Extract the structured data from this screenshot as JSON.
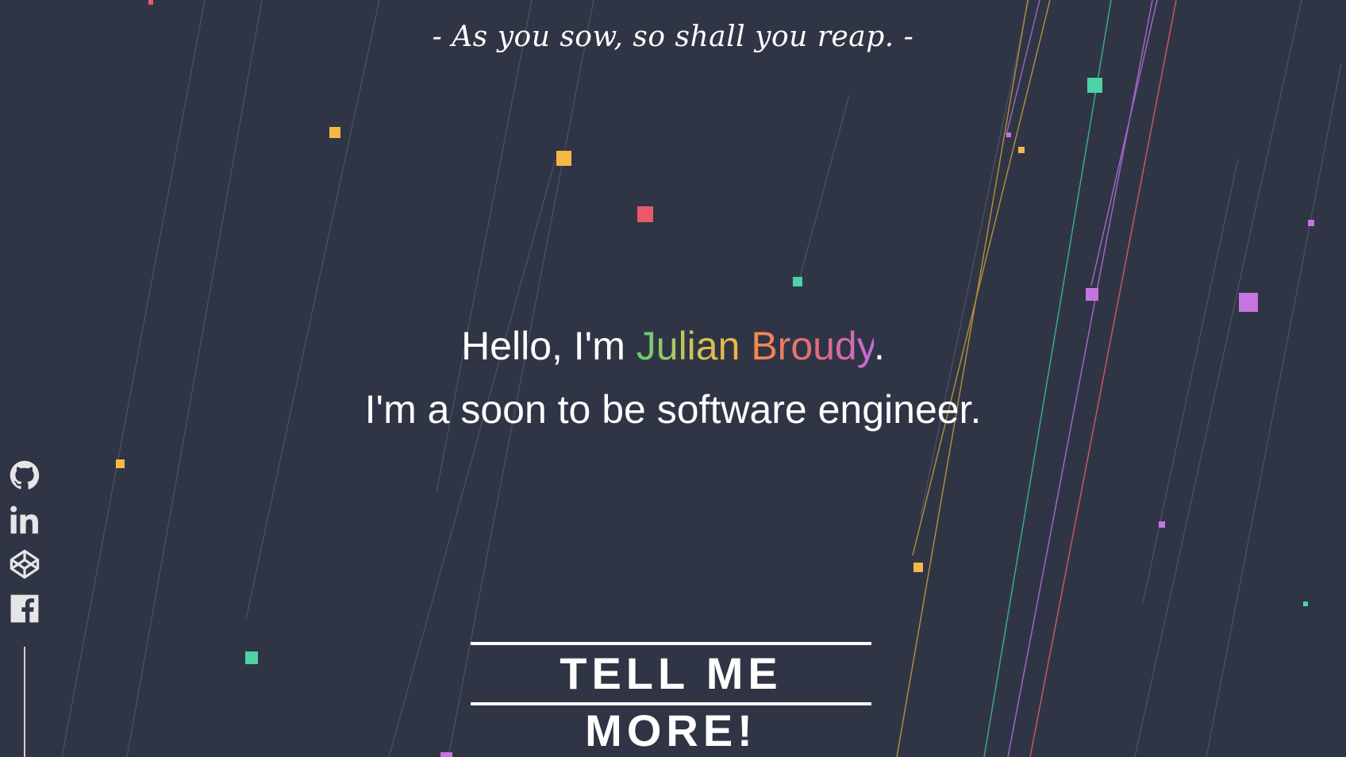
{
  "quote": "- As you sow, so shall you reap. -",
  "hero": {
    "greeting": "Hello, I'm ",
    "first_name": "Julian",
    "last_name": "Broudy",
    "punctuation": ".",
    "tagline": "I'm a soon to be software engineer."
  },
  "cta_label": "TELL ME MORE!",
  "social": {
    "github_icon": "github-icon",
    "linkedin_icon": "linkedin-icon",
    "codepen_icon": "codepen-icon",
    "facebook_icon": "facebook-icon"
  },
  "colors": {
    "background": "#303545",
    "yellow": "#f4b844",
    "red": "#e85a67",
    "teal": "#4fd1a6",
    "purple": "#c674e0",
    "line": "#4a5060"
  }
}
